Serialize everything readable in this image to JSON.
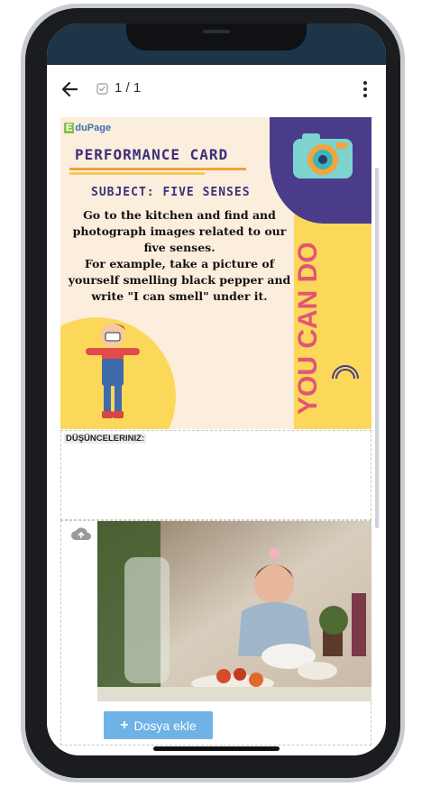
{
  "appbar": {
    "page_indicator": "1 / 1"
  },
  "card": {
    "logo_letter": "E",
    "logo_text": "duPage",
    "title": "PERFORMANCE CARD",
    "subject": "SUBJECT: FIVE SENSES",
    "instruction": "Go to the kitchen and find and photograph images related to our five senses.\nFor example, take a picture of yourself smelling black pepper and write \"I can smell\" under it.",
    "slogan": "YOU CAN DO IT!"
  },
  "thoughts": {
    "label": "DÜŞÜNCELERINIZ:"
  },
  "upload": {
    "add_file_label": "Dosya ekle"
  },
  "colors": {
    "statusbar": "#1e3447",
    "accent_button": "#6fb2e6",
    "card_bg": "#fbeedd",
    "purple": "#4a3b8b",
    "yellow": "#fcd85a"
  },
  "icons": [
    "back-arrow-icon",
    "checkbox-icon",
    "more-vert-icon",
    "cloud-upload-icon",
    "plus-icon",
    "camera-icon"
  ]
}
